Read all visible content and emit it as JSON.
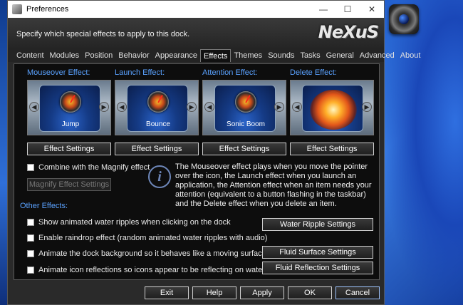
{
  "window": {
    "title": "Preferences",
    "minimize": "—",
    "maximize": "☐",
    "close": "✕"
  },
  "header": {
    "description": "Specify which special effects to apply to this dock.",
    "logo": "NeXuS"
  },
  "tabs": [
    "Content",
    "Modules",
    "Position",
    "Behavior",
    "Appearance",
    "Effects",
    "Themes",
    "Sounds",
    "Tasks",
    "General",
    "Advanced",
    "About"
  ],
  "active_tab": "Effects",
  "effects": [
    {
      "title": "Mouseover Effect:",
      "caption": "Jump",
      "button": "Effect Settings"
    },
    {
      "title": "Launch Effect:",
      "caption": "Bounce",
      "button": "Effect Settings"
    },
    {
      "title": "Attention Effect:",
      "caption": "Sonic Boom",
      "button": "Effect Settings"
    },
    {
      "title": "Delete Effect:",
      "caption": "",
      "button": "Effect Settings"
    }
  ],
  "combine": {
    "label": "Combine with the Magnify effect",
    "button": "Magnify Effect Settings"
  },
  "info_text": "The Mouseover effect plays when you move the pointer over the icon, the Launch effect when you launch an application, the Attention effect when an item needs your attention (equivalent to a button flashing in the taskbar) and the Delete effect when you delete an item.",
  "other_effects": {
    "title": "Other Effects:",
    "options": [
      "Show animated water ripples when clicking on the dock",
      "Enable raindrop effect (random animated water ripples with audio)",
      "Animate the dock background so it behaves like a moving surface",
      "Animate icon reflections so icons appear to be reflecting on water"
    ],
    "buttons": [
      "Water Ripple Settings",
      "Fluid Surface Settings",
      "Fluid Reflection Settings"
    ]
  },
  "footer": {
    "exit": "Exit",
    "help": "Help",
    "apply": "Apply",
    "ok": "OK",
    "cancel": "Cancel"
  },
  "icons": {
    "arrow_left": "◀",
    "arrow_right": "▶",
    "info": "i"
  }
}
